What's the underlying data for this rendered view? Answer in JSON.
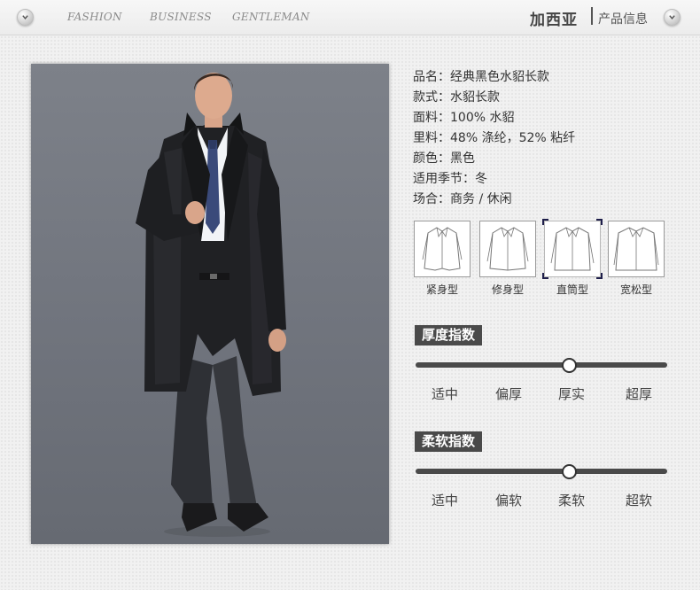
{
  "header": {
    "nav": [
      "FASHION",
      "BUSINESS",
      "GENTLEMAN"
    ],
    "brand": "加西亚",
    "subtitle": "产品信息"
  },
  "product": {
    "info": [
      "品名：经典黑色水貂长款",
      "款式：水貂长款",
      "面料：100% 水貂",
      "里料：48% 涤纶，52% 粘纤",
      "颜色：黑色",
      "适用季节：冬",
      "场合：商务 / 休闲"
    ],
    "fit_types": [
      "紧身型",
      "修身型",
      "直筒型",
      "宽松型"
    ],
    "selected_fit": "直筒型"
  },
  "thickness": {
    "title": "厚度指数",
    "labels": [
      "适中",
      "偏厚",
      "厚实",
      "超厚"
    ],
    "level_percent": 61
  },
  "softness": {
    "title": "柔软指数",
    "labels": [
      "适中",
      "偏软",
      "柔软",
      "超软"
    ],
    "level_percent": 61
  },
  "colors": {
    "label_bg": "#4a4a4a",
    "selected_corner": "#1e1e4a"
  }
}
